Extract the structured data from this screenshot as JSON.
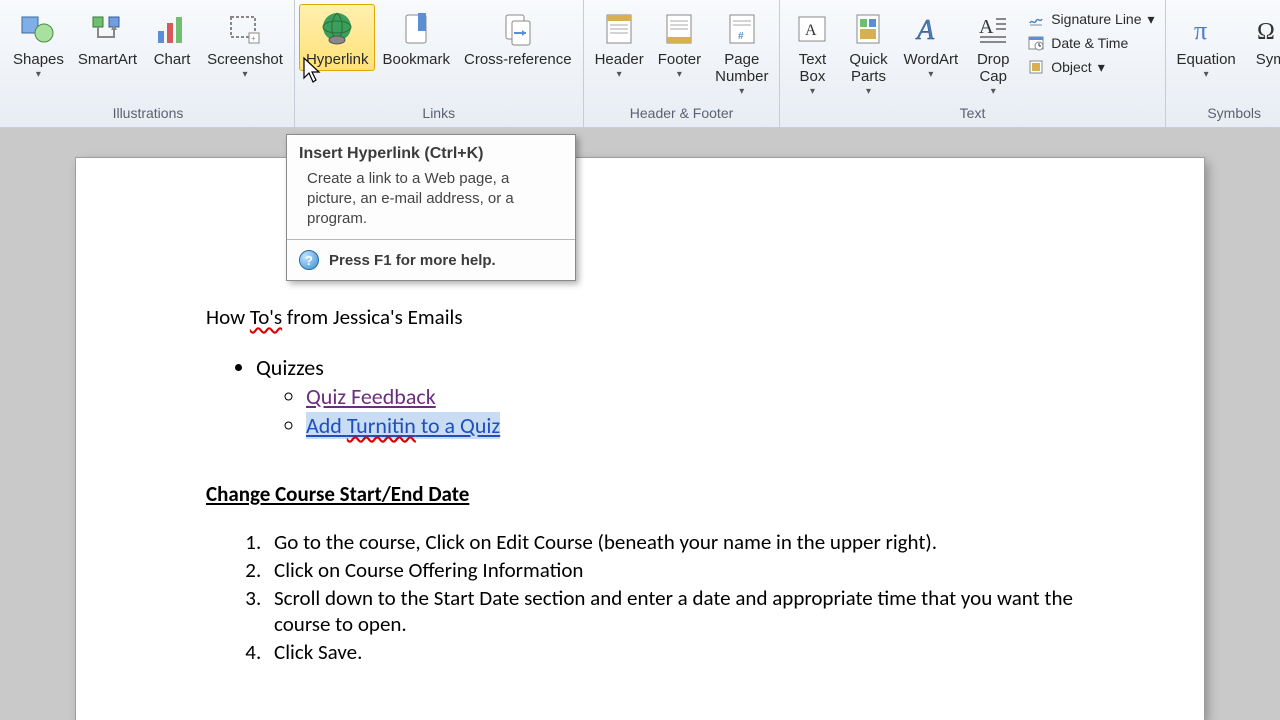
{
  "ribbon": {
    "illustrations": {
      "label": "Illustrations",
      "shapes": "Shapes",
      "smartart": "SmartArt",
      "chart": "Chart",
      "screenshot": "Screenshot"
    },
    "links": {
      "label": "Links",
      "hyperlink": "Hyperlink",
      "bookmark": "Bookmark",
      "crossref": "Cross-reference"
    },
    "headerfooter": {
      "label": "Header & Footer",
      "header": "Header",
      "footer": "Footer",
      "pagenumber": "Page\nNumber"
    },
    "text": {
      "label": "Text",
      "textbox": "Text\nBox",
      "quickparts": "Quick\nParts",
      "wordart": "WordArt",
      "dropcap": "Drop\nCap",
      "signature": "Signature Line",
      "datetime": "Date & Time",
      "object": "Object"
    },
    "symbols": {
      "label": "Symbols",
      "equation": "Equation",
      "symbol": "Sym"
    }
  },
  "tooltip": {
    "title": "Insert Hyperlink (Ctrl+K)",
    "body": "Create a link to a Web page, a picture, an e-mail address, or a program.",
    "help_text": "Press F1 for more help."
  },
  "document": {
    "title_pre": "How ",
    "title_spell": "To's",
    "title_post": " from Jessica's Emails",
    "bullet1": "Quizzes",
    "sub1": "Quiz Feedback",
    "sub2_pre": "Add ",
    "sub2_spell": "Turnitin",
    "sub2_post": " to a Quiz",
    "section": "Change Course Start/End Date",
    "steps": {
      "s1": "Go to the course, Click on Edit Course (beneath your name in the upper right).",
      "s2": "Click on Course Offering Information",
      "s3": "Scroll down to the Start Date section and enter a date and appropriate time that you want the course to open.",
      "s4": "Click Save."
    }
  }
}
